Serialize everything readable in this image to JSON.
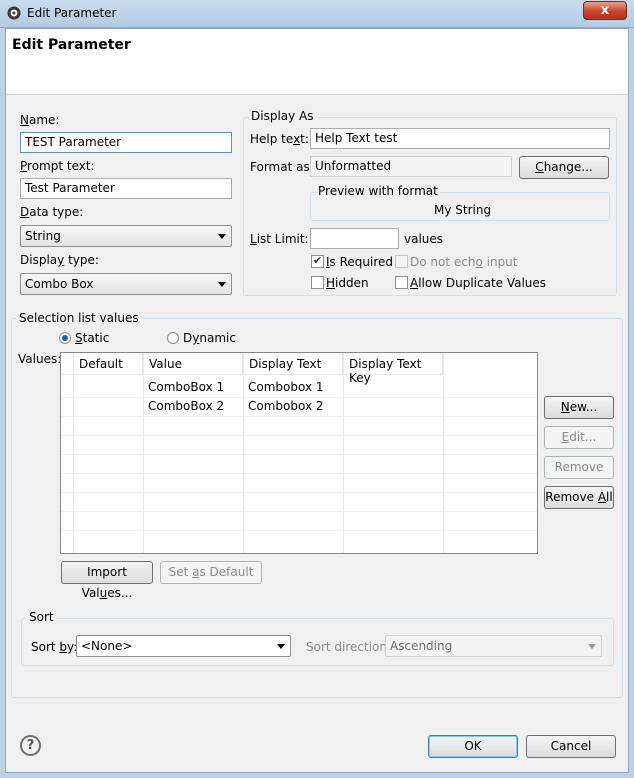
{
  "window": {
    "title": "Edit Parameter",
    "close_glyph": "x"
  },
  "header": {
    "title": "Edit Parameter"
  },
  "left": {
    "name_label": "Name:",
    "name_value": "TEST Parameter",
    "prompt_label": "Prompt text:",
    "prompt_value": "Test Parameter",
    "data_type_label": "Data type:",
    "data_type_value": "String",
    "display_type_label": "Display type:",
    "display_type_value": "Combo Box"
  },
  "display_as": {
    "title": "Display As",
    "help_text_label": "Help text:",
    "help_text_value": "Help Text test",
    "format_as_label": "Format as:",
    "format_as_value": "Unformatted",
    "change_button": "Change...",
    "preview_title": "Preview with format",
    "preview_value": "My String",
    "list_limit_label": "List Limit:",
    "list_limit_value": "",
    "values_suffix": "values",
    "is_required": {
      "label": "Is Required",
      "checked": true
    },
    "do_not_echo": {
      "label": "Do not echo input",
      "checked": false
    },
    "hidden": {
      "label": "Hidden",
      "checked": false
    },
    "allow_duplicates": {
      "label": "Allow Duplicate Values",
      "checked": false
    }
  },
  "selection": {
    "title": "Selection list values",
    "static_label": "Static",
    "dynamic_label": "Dynamic",
    "selected": "Static",
    "values_label": "Values:",
    "columns": [
      "Default",
      "Value",
      "Display Text",
      "Display Text Key"
    ],
    "rows": [
      {
        "default": "",
        "value": "ComboBox 1",
        "display_text": "Combobox 1",
        "display_text_key": ""
      },
      {
        "default": "",
        "value": "ComboBox 2",
        "display_text": "Combobox 2",
        "display_text_key": ""
      }
    ],
    "new_button": "New...",
    "edit_button": "Edit...",
    "remove_button": "Remove",
    "remove_all_button": "Remove All",
    "import_button": "Import Values...",
    "set_default_button": "Set as Default"
  },
  "sort": {
    "title": "Sort",
    "sort_by_label": "Sort by:",
    "sort_by_value": "<None>",
    "direction_label": "Sort direction:",
    "direction_value": "Ascending"
  },
  "footer": {
    "help_glyph": "?",
    "ok_button": "OK",
    "cancel_button": "Cancel"
  }
}
